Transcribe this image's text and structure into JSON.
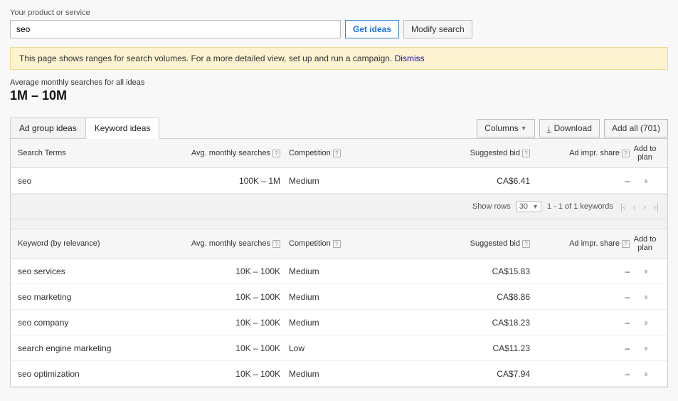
{
  "search": {
    "label": "Your product or service",
    "value": "seo",
    "get_ideas": "Get ideas",
    "modify": "Modify search"
  },
  "banner": {
    "text": "This page shows ranges for search volumes. For a more detailed view, set up and run a campaign. ",
    "dismiss": "Dismiss"
  },
  "summary": {
    "label": "Average monthly searches for all ideas",
    "value": "1M – 10M"
  },
  "tabs": {
    "adgroup": "Ad group ideas",
    "keyword": "Keyword ideas"
  },
  "controls": {
    "columns": "Columns",
    "download": "Download",
    "add_all": "Add all (701)"
  },
  "headers": {
    "search_terms": "Search Terms",
    "keyword_relevance": "Keyword (by relevance)",
    "avg": "Avg. monthly searches",
    "competition": "Competition",
    "bid": "Suggested bid",
    "share": "Ad impr. share",
    "add": "Add to plan"
  },
  "search_term_rows": [
    {
      "term": "seo",
      "avg": "100K – 1M",
      "competition": "Medium",
      "bid": "CA$6.41",
      "share": "–"
    }
  ],
  "pagination": {
    "show_rows": "Show rows",
    "rows_value": "30",
    "range": "1 - 1 of 1 keywords"
  },
  "keyword_rows": [
    {
      "term": "seo services",
      "avg": "10K – 100K",
      "competition": "Medium",
      "bid": "CA$15.83",
      "share": "–"
    },
    {
      "term": "seo marketing",
      "avg": "10K – 100K",
      "competition": "Medium",
      "bid": "CA$8.86",
      "share": "–"
    },
    {
      "term": "seo company",
      "avg": "10K – 100K",
      "competition": "Medium",
      "bid": "CA$18.23",
      "share": "–"
    },
    {
      "term": "search engine marketing",
      "avg": "10K – 100K",
      "competition": "Low",
      "bid": "CA$11.23",
      "share": "–"
    },
    {
      "term": "seo optimization",
      "avg": "10K – 100K",
      "competition": "Medium",
      "bid": "CA$7.94",
      "share": "–"
    }
  ]
}
